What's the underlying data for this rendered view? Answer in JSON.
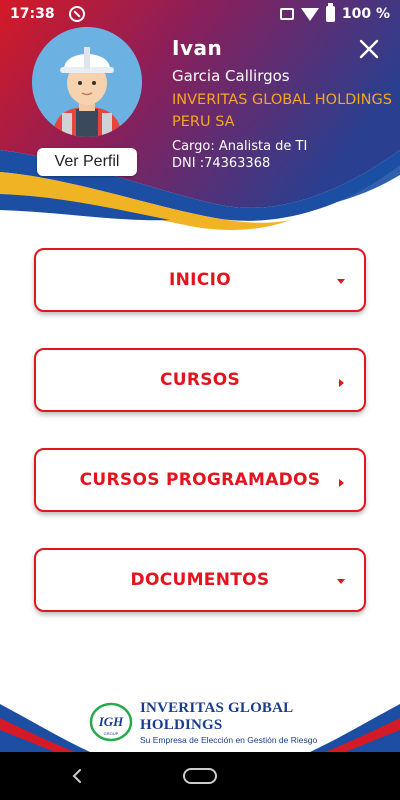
{
  "status_bar": {
    "time": "17:38",
    "battery": "100 %"
  },
  "profile": {
    "first_name": "Ivan",
    "last_name": "Garcia Callirgos",
    "company": "INVERITAS GLOBAL HOLDINGS PERU SA",
    "cargo": "Cargo: Analista de TI",
    "dni": "DNI :74363368",
    "view_profile_label": "Ver Perfil"
  },
  "menu": {
    "items": [
      {
        "label": "INICIO",
        "arrow": "caret-down"
      },
      {
        "label": "CURSOS",
        "arrow": "caret-right"
      },
      {
        "label": "CURSOS PROGRAMADOS",
        "arrow": "caret-right"
      },
      {
        "label": "DOCUMENTOS",
        "arrow": "caret-down"
      }
    ]
  },
  "footer": {
    "logo_mark": "IGH",
    "logo_mark_sub": "GROUP",
    "logo_title": "INVERITAS GLOBAL HOLDINGS",
    "logo_subtitle": "Su Empresa de Elección en Gestión de Riesgo"
  },
  "colors": {
    "accent": "#e3141d",
    "brand_blue": "#1b3c8c",
    "header_blue": "#1c4fa3",
    "company_orange": "#f5a623"
  }
}
